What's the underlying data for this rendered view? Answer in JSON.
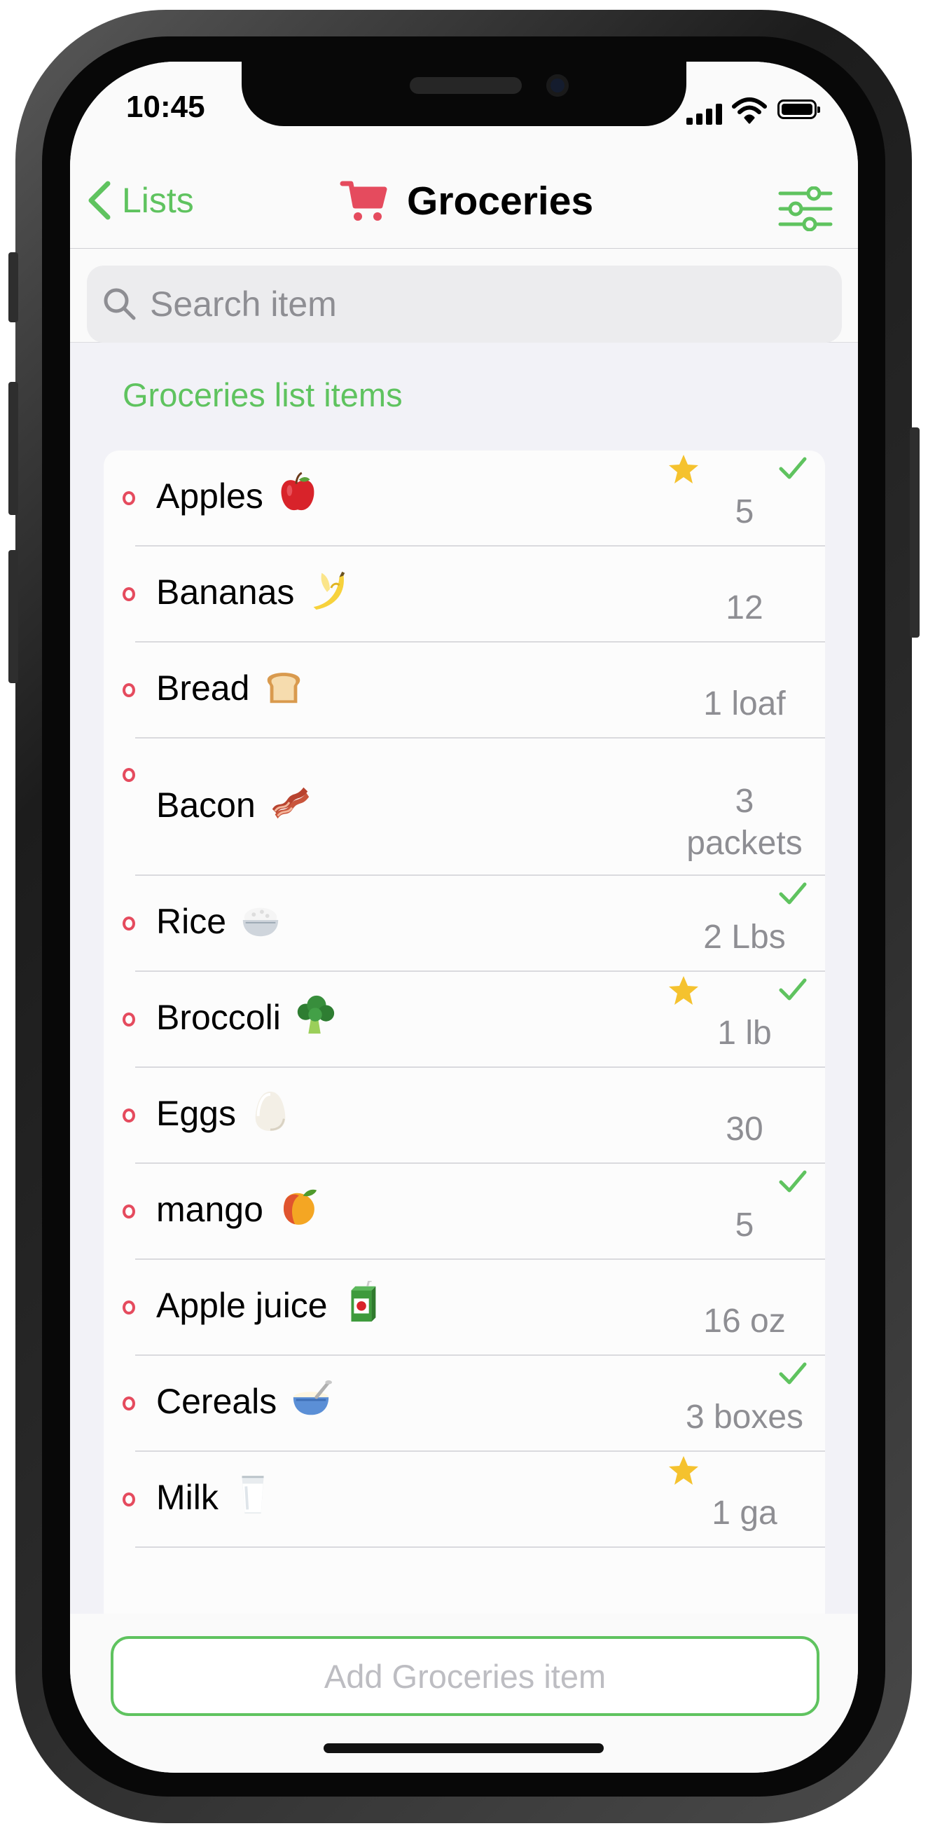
{
  "status_bar": {
    "time": "10:45"
  },
  "nav": {
    "back_label": "Lists",
    "title": "Groceries",
    "accent_color": "#5fc35f",
    "cart_color": "#e54b5e"
  },
  "search": {
    "placeholder": "Search item"
  },
  "section_header": "Groceries list items",
  "items": [
    {
      "name": "Apples",
      "emoji": "apple",
      "quantity": "5",
      "starred": true,
      "checked": true
    },
    {
      "name": "Bananas",
      "emoji": "banana",
      "quantity": "12",
      "starred": false,
      "checked": false
    },
    {
      "name": "Bread",
      "emoji": "bread",
      "quantity": "1 loaf",
      "starred": false,
      "checked": false
    },
    {
      "name": "Bacon",
      "emoji": "bacon",
      "quantity": "3 packets",
      "starred": false,
      "checked": false
    },
    {
      "name": "Rice",
      "emoji": "rice",
      "quantity": "2 Lbs",
      "starred": false,
      "checked": true
    },
    {
      "name": "Broccoli",
      "emoji": "broccoli",
      "quantity": "1 lb",
      "starred": true,
      "checked": true
    },
    {
      "name": "Eggs",
      "emoji": "egg",
      "quantity": "30",
      "starred": false,
      "checked": false
    },
    {
      "name": "mango",
      "emoji": "mango",
      "quantity": "5",
      "starred": false,
      "checked": true
    },
    {
      "name": "Apple juice",
      "emoji": "juice-box",
      "quantity": "16 oz",
      "starred": false,
      "checked": false
    },
    {
      "name": "Cereals",
      "emoji": "cereal-bowl",
      "quantity": "3 boxes",
      "starred": false,
      "checked": true
    },
    {
      "name": "Milk",
      "emoji": "milk-glass",
      "quantity": "1 ga",
      "starred": true,
      "checked": false
    }
  ],
  "add_button": {
    "label": "Add Groceries item"
  }
}
